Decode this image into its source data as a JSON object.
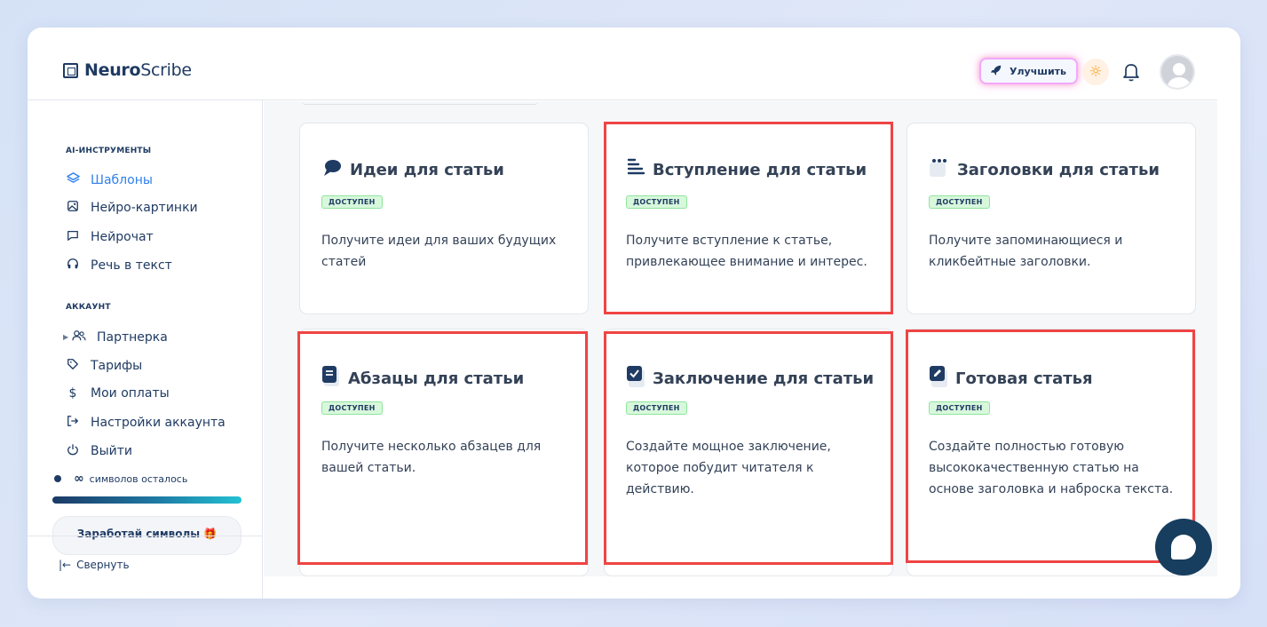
{
  "brand": {
    "bold": "Neuro",
    "regular": "Scribe"
  },
  "header": {
    "upgrade_label": "Улучшить"
  },
  "sidebar": {
    "ai_section": "AI-ИНСТРУМЕНТЫ",
    "ai_items": [
      {
        "label": "Шаблоны",
        "icon": "layers-icon",
        "active": true
      },
      {
        "label": "Нейро-картинки",
        "icon": "image-icon"
      },
      {
        "label": "Нейрочат",
        "icon": "chat-icon"
      },
      {
        "label": "Речь в текст",
        "icon": "headphones-icon"
      }
    ],
    "account_section": "АККАУНТ",
    "account_items": [
      {
        "label": "Партнерка",
        "icon": "users-icon"
      },
      {
        "label": "Тарифы",
        "icon": "tag-icon"
      },
      {
        "label": "Мои оплаты",
        "icon": "dollar-icon"
      },
      {
        "label": "Настройки аккаунта",
        "icon": "logout-arrow-icon"
      },
      {
        "label": "Выйти",
        "icon": "power-icon"
      }
    ],
    "credits": {
      "symbol": "∞",
      "text": "символов осталось"
    },
    "earn_label": "Заработай символы 🎁",
    "collapse_label": "Свернуть"
  },
  "cards": [
    {
      "title": "Идеи для статьи",
      "badge": "ДОСТУПЕН",
      "desc": "Получите идеи для ваших будущих статей",
      "icon": "speech-bubble-icon"
    },
    {
      "title": "Вступление для статьи",
      "badge": "ДОСТУПЕН",
      "desc": "Получите вступление к статье, привлекающее внимание и интерес.",
      "icon": "lines-icon"
    },
    {
      "title": "Заголовки для статьи",
      "badge": "ДОСТУПЕН",
      "desc": "Получите запоминающиеся и кликбейтные заголовки.",
      "icon": "dots-icon"
    },
    {
      "title": "Абзацы для статьи",
      "badge": "ДОСТУПЕН",
      "desc": "Получите несколько абзацев для вашей статьи.",
      "icon": "book-icon"
    },
    {
      "title": "Заключение для статьи",
      "badge": "ДОСТУПЕН",
      "desc": "Создайте мощное заключение, которое побудит читателя к действию.",
      "icon": "checkbox-icon"
    },
    {
      "title": "Готовая статья",
      "badge": "ДОСТУПЕН",
      "desc": "Создайте полностью готовую высококачественную статью на основе заголовка и наброска текста.",
      "icon": "pencil-icon"
    }
  ],
  "colors": {
    "accent": "#2f80ed",
    "primary": "#1f3b63",
    "highlight": "#ef4444",
    "badge_bg": "#d8f8dc"
  }
}
